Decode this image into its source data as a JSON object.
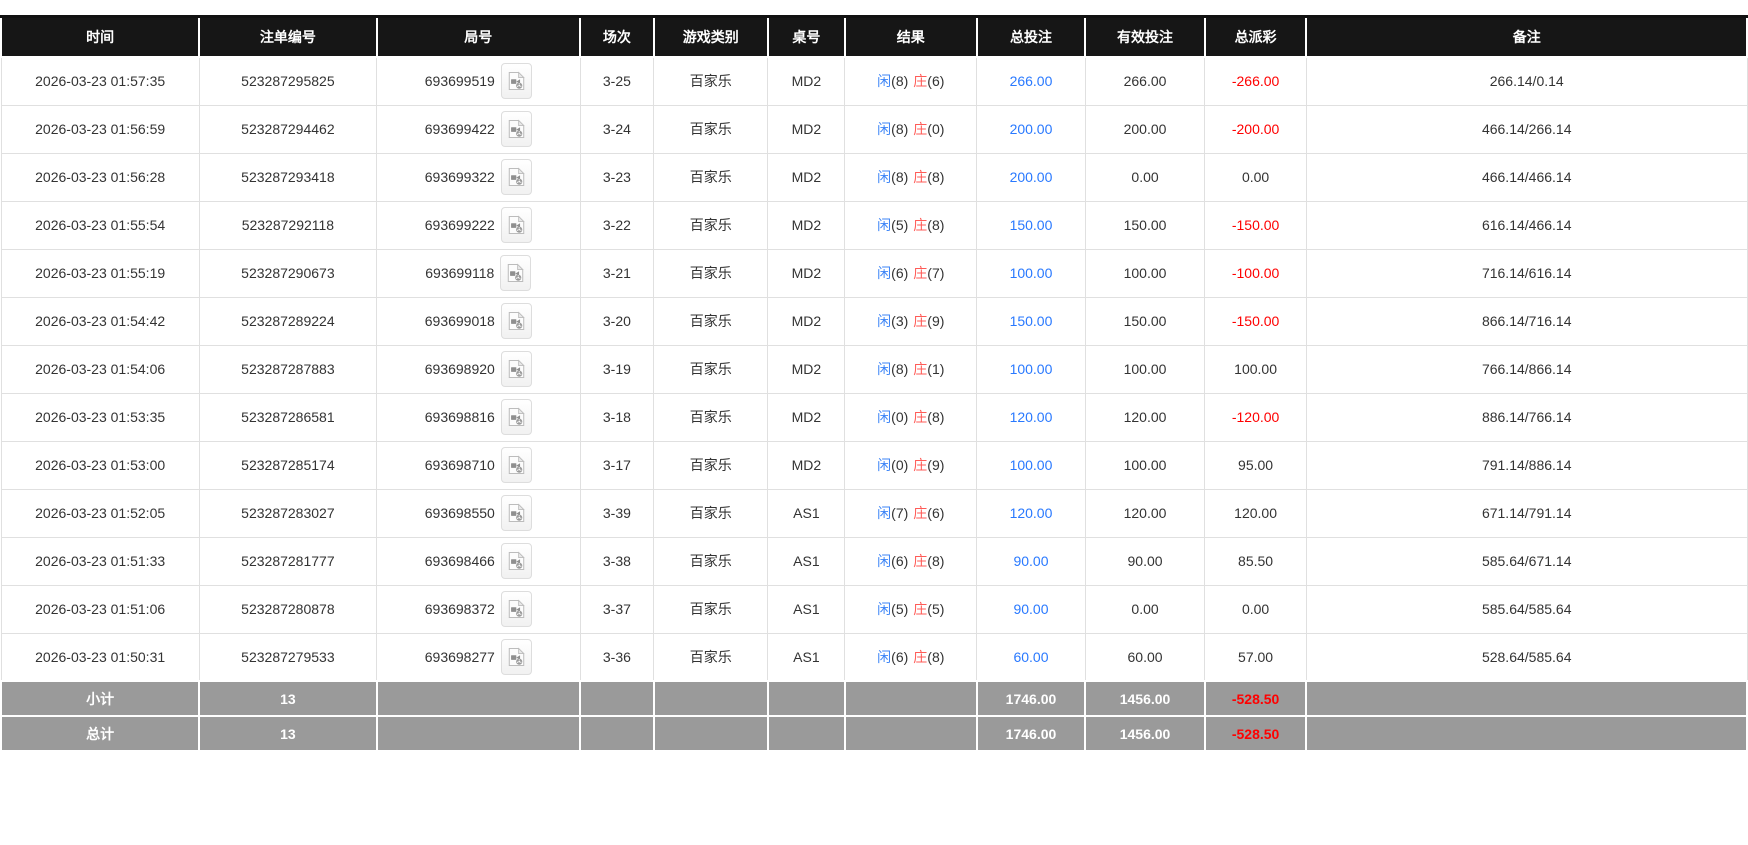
{
  "colors": {
    "header_bg": "#161616",
    "amount_blue": "#2979ff",
    "player_blue": "#3d85f7",
    "banker_red": "#ff5b57",
    "negative_red": "#ff0000",
    "summary_bg": "#9a9a9a",
    "row_border": "#e0e0e0"
  },
  "table": {
    "columns": [
      {
        "key": "time",
        "label": "时间"
      },
      {
        "key": "bet_id",
        "label": "注单编号"
      },
      {
        "key": "round_id",
        "label": "局号"
      },
      {
        "key": "session",
        "label": "场次"
      },
      {
        "key": "game_type",
        "label": "游戏类别"
      },
      {
        "key": "table_no",
        "label": "桌号"
      },
      {
        "key": "result",
        "label": "结果"
      },
      {
        "key": "total_bet",
        "label": "总投注"
      },
      {
        "key": "valid_bet",
        "label": "有效投注"
      },
      {
        "key": "total_payout",
        "label": "总派彩"
      },
      {
        "key": "remark",
        "label": "备注"
      }
    ],
    "video_icon_name": "video-replay-file-icon",
    "rows": [
      {
        "time": "2026-03-23 01:57:35",
        "bet_id": "523287295825",
        "round_id": "693699519",
        "session": "3-25",
        "game_type": "百家乐",
        "table_no": "MD2",
        "result": {
          "player_label": "闲",
          "player_score": "(8)",
          "banker_label": "庄",
          "banker_score": "(6)"
        },
        "total_bet": "266.00",
        "valid_bet": "266.00",
        "total_payout": "-266.00",
        "remark": "266.14/0.14"
      },
      {
        "time": "2026-03-23 01:56:59",
        "bet_id": "523287294462",
        "round_id": "693699422",
        "session": "3-24",
        "game_type": "百家乐",
        "table_no": "MD2",
        "result": {
          "player_label": "闲",
          "player_score": "(8)",
          "banker_label": "庄",
          "banker_score": "(0)"
        },
        "total_bet": "200.00",
        "valid_bet": "200.00",
        "total_payout": "-200.00",
        "remark": "466.14/266.14"
      },
      {
        "time": "2026-03-23 01:56:28",
        "bet_id": "523287293418",
        "round_id": "693699322",
        "session": "3-23",
        "game_type": "百家乐",
        "table_no": "MD2",
        "result": {
          "player_label": "闲",
          "player_score": "(8)",
          "banker_label": "庄",
          "banker_score": "(8)"
        },
        "total_bet": "200.00",
        "valid_bet": "0.00",
        "total_payout": "0.00",
        "remark": "466.14/466.14"
      },
      {
        "time": "2026-03-23 01:55:54",
        "bet_id": "523287292118",
        "round_id": "693699222",
        "session": "3-22",
        "game_type": "百家乐",
        "table_no": "MD2",
        "result": {
          "player_label": "闲",
          "player_score": "(5)",
          "banker_label": "庄",
          "banker_score": "(8)"
        },
        "total_bet": "150.00",
        "valid_bet": "150.00",
        "total_payout": "-150.00",
        "remark": "616.14/466.14"
      },
      {
        "time": "2026-03-23 01:55:19",
        "bet_id": "523287290673",
        "round_id": "693699118",
        "session": "3-21",
        "game_type": "百家乐",
        "table_no": "MD2",
        "result": {
          "player_label": "闲",
          "player_score": "(6)",
          "banker_label": "庄",
          "banker_score": "(7)"
        },
        "total_bet": "100.00",
        "valid_bet": "100.00",
        "total_payout": "-100.00",
        "remark": "716.14/616.14"
      },
      {
        "time": "2026-03-23 01:54:42",
        "bet_id": "523287289224",
        "round_id": "693699018",
        "session": "3-20",
        "game_type": "百家乐",
        "table_no": "MD2",
        "result": {
          "player_label": "闲",
          "player_score": "(3)",
          "banker_label": "庄",
          "banker_score": "(9)"
        },
        "total_bet": "150.00",
        "valid_bet": "150.00",
        "total_payout": "-150.00",
        "remark": "866.14/716.14"
      },
      {
        "time": "2026-03-23 01:54:06",
        "bet_id": "523287287883",
        "round_id": "693698920",
        "session": "3-19",
        "game_type": "百家乐",
        "table_no": "MD2",
        "result": {
          "player_label": "闲",
          "player_score": "(8)",
          "banker_label": "庄",
          "banker_score": "(1)"
        },
        "total_bet": "100.00",
        "valid_bet": "100.00",
        "total_payout": "100.00",
        "remark": "766.14/866.14"
      },
      {
        "time": "2026-03-23 01:53:35",
        "bet_id": "523287286581",
        "round_id": "693698816",
        "session": "3-18",
        "game_type": "百家乐",
        "table_no": "MD2",
        "result": {
          "player_label": "闲",
          "player_score": "(0)",
          "banker_label": "庄",
          "banker_score": "(8)"
        },
        "total_bet": "120.00",
        "valid_bet": "120.00",
        "total_payout": "-120.00",
        "remark": "886.14/766.14"
      },
      {
        "time": "2026-03-23 01:53:00",
        "bet_id": "523287285174",
        "round_id": "693698710",
        "session": "3-17",
        "game_type": "百家乐",
        "table_no": "MD2",
        "result": {
          "player_label": "闲",
          "player_score": "(0)",
          "banker_label": "庄",
          "banker_score": "(9)"
        },
        "total_bet": "100.00",
        "valid_bet": "100.00",
        "total_payout": "95.00",
        "remark": "791.14/886.14"
      },
      {
        "time": "2026-03-23 01:52:05",
        "bet_id": "523287283027",
        "round_id": "693698550",
        "session": "3-39",
        "game_type": "百家乐",
        "table_no": "AS1",
        "result": {
          "player_label": "闲",
          "player_score": "(7)",
          "banker_label": "庄",
          "banker_score": "(6)"
        },
        "total_bet": "120.00",
        "valid_bet": "120.00",
        "total_payout": "120.00",
        "remark": "671.14/791.14"
      },
      {
        "time": "2026-03-23 01:51:33",
        "bet_id": "523287281777",
        "round_id": "693698466",
        "session": "3-38",
        "game_type": "百家乐",
        "table_no": "AS1",
        "result": {
          "player_label": "闲",
          "player_score": "(6)",
          "banker_label": "庄",
          "banker_score": "(8)"
        },
        "total_bet": "90.00",
        "valid_bet": "90.00",
        "total_payout": "85.50",
        "remark": "585.64/671.14"
      },
      {
        "time": "2026-03-23 01:51:06",
        "bet_id": "523287280878",
        "round_id": "693698372",
        "session": "3-37",
        "game_type": "百家乐",
        "table_no": "AS1",
        "result": {
          "player_label": "闲",
          "player_score": "(5)",
          "banker_label": "庄",
          "banker_score": "(5)"
        },
        "total_bet": "90.00",
        "valid_bet": "0.00",
        "total_payout": "0.00",
        "remark": "585.64/585.64"
      },
      {
        "time": "2026-03-23 01:50:31",
        "bet_id": "523287279533",
        "round_id": "693698277",
        "session": "3-36",
        "game_type": "百家乐",
        "table_no": "AS1",
        "result": {
          "player_label": "闲",
          "player_score": "(6)",
          "banker_label": "庄",
          "banker_score": "(8)"
        },
        "total_bet": "60.00",
        "valid_bet": "60.00",
        "total_payout": "57.00",
        "remark": "528.64/585.64"
      }
    ],
    "summary_rows": [
      {
        "label": "小计",
        "count": "13",
        "total_bet": "1746.00",
        "valid_bet": "1456.00",
        "total_payout": "-528.50"
      },
      {
        "label": "总计",
        "count": "13",
        "total_bet": "1746.00",
        "valid_bet": "1456.00",
        "total_payout": "-528.50"
      }
    ]
  }
}
